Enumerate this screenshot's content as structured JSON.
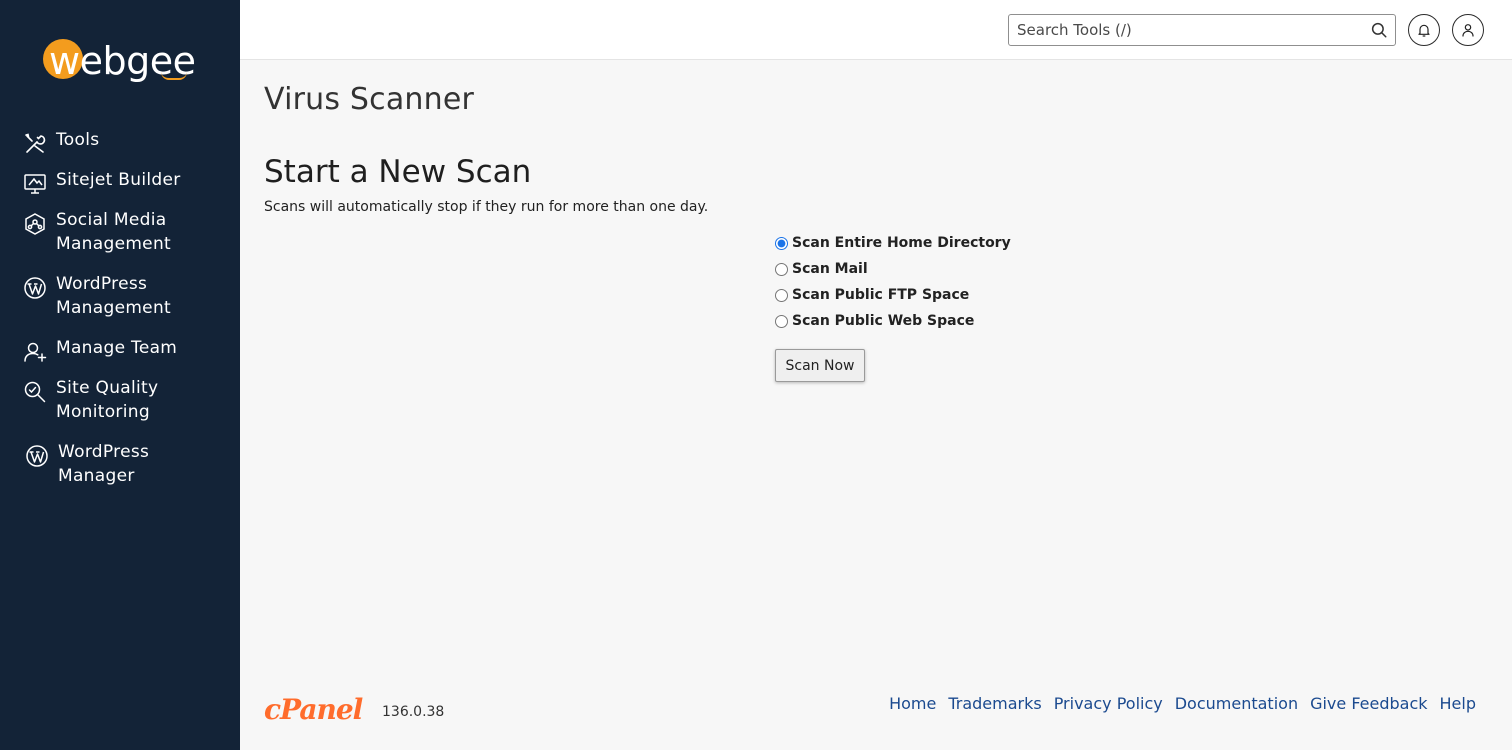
{
  "brand": {
    "logo_text": "webgee",
    "accent": "#f39c1e",
    "sidebar_bg": "#132337"
  },
  "sidebar": {
    "items": [
      {
        "label": "Tools",
        "icon": "tools-icon"
      },
      {
        "label": "Sitejet Builder",
        "icon": "sitejet-icon"
      },
      {
        "label": "Social Media\nManagement",
        "icon": "social-media-icon"
      },
      {
        "label": "WordPress\nManagement",
        "icon": "wordpress-icon"
      },
      {
        "label": "Manage Team",
        "icon": "manage-team-icon"
      },
      {
        "label": "Site Quality\nMonitoring",
        "icon": "site-quality-icon"
      },
      {
        "label": "WordPress\nManager",
        "icon": "wordpress-icon"
      }
    ]
  },
  "header": {
    "search_placeholder": "Search Tools (/)",
    "notifications_icon": "bell-icon",
    "user_icon": "user-icon"
  },
  "main": {
    "page_title": "Virus Scanner",
    "section_title": "Start a New Scan",
    "note": "Scans will automatically stop if they run for more than one day.",
    "options": [
      {
        "label": "Scan Entire Home Directory",
        "checked": true
      },
      {
        "label": "Scan Mail",
        "checked": false
      },
      {
        "label": "Scan Public FTP Space",
        "checked": false
      },
      {
        "label": "Scan Public Web Space",
        "checked": false
      }
    ],
    "scan_button": "Scan Now"
  },
  "footer": {
    "logo_text": "cPanel",
    "logo_color": "#ff6c2c",
    "version": "136.0.38",
    "links": [
      "Home",
      "Trademarks",
      "Privacy Policy",
      "Documentation",
      "Give Feedback",
      "Help"
    ],
    "link_color": "#1b4a8f"
  }
}
